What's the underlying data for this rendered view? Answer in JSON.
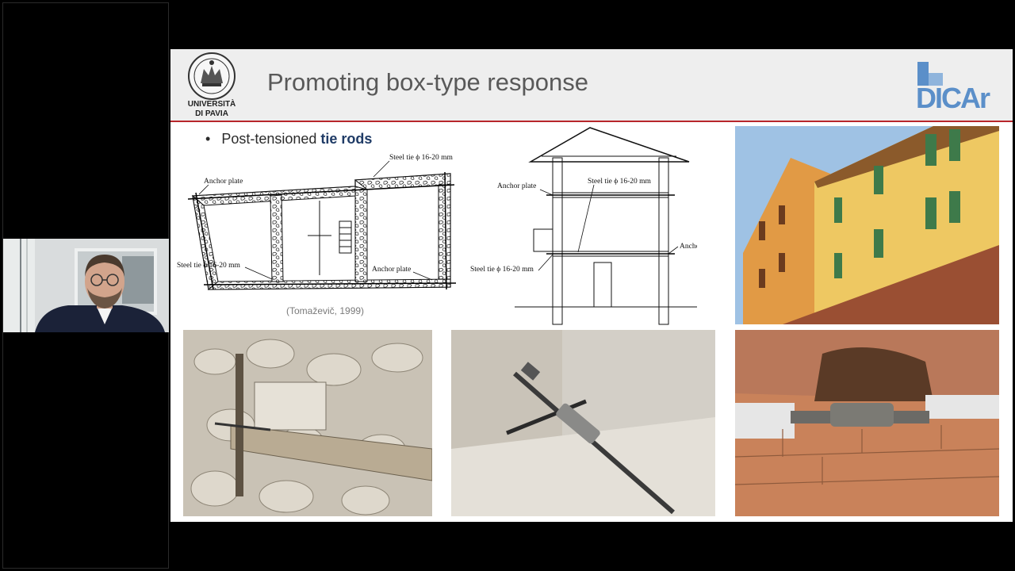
{
  "slide": {
    "title": "Promoting box-type response",
    "university": {
      "line1": "UNIVERSITÀ",
      "line2": "DI PAVIA"
    },
    "dept_logo": "DICAr",
    "bullet": {
      "prefix": "Post-tensioned ",
      "highlight": "tie rods"
    },
    "citation": "(Tomaževič, 1999)",
    "plan_drawing": {
      "labels": {
        "steel_tie_top": "Steel tie ϕ 16-20 mm",
        "anchor_plate_top": "Anchor plate",
        "steel_tie_left": "Steel tie ϕ 16-20 mm",
        "anchor_plate_bottom": "Anchor plate"
      }
    },
    "section_drawing": {
      "labels": {
        "anchor_plate_left": "Anchor plate",
        "steel_tie_upper": "Steel tie ϕ 16-20 mm",
        "steel_tie_lower": "Steel tie ϕ 16-20 mm",
        "anchor_plate_right": "Anchor plate"
      }
    }
  },
  "colors": {
    "header_bg": "#eeeeee",
    "header_rule": "#b8262b",
    "title": "#595959",
    "highlight": "#1f3b66",
    "dicar_blue": "#5b8fc9"
  }
}
